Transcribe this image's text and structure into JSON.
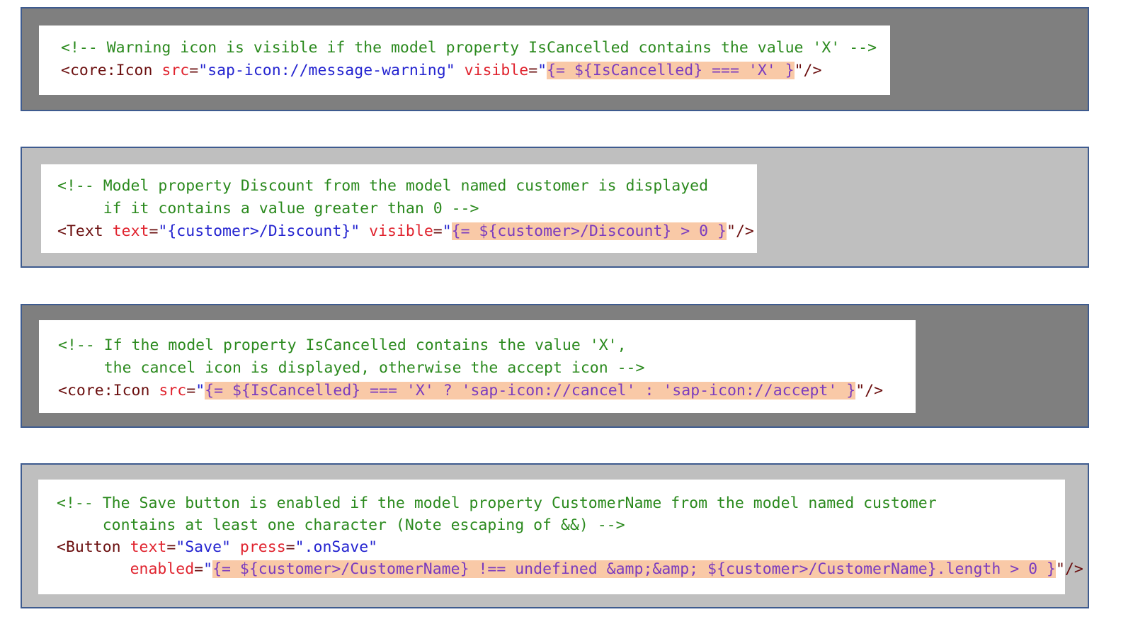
{
  "colors": {
    "panel_border": "#3e5b8f",
    "panel_dark": "#7f7f7f",
    "panel_light": "#bfbfbf",
    "comment": "#2b8a1e",
    "tag": "#6b0f0f",
    "attribute": "#e0232e",
    "string": "#2424d0",
    "highlight_bg": "#f9c9a7",
    "highlight_text": "#7a3bbf"
  },
  "examples": [
    {
      "comment": "<!-- Warning icon is visible if the model property IsCancelled contains the value 'X' -->",
      "tag_open": "<core:Icon",
      "attr1_name": "src",
      "attr1_value": "\"sap-icon://message-warning\"",
      "attr2_name": "visible",
      "expr_open_quote": "\"",
      "expression": "{= ${IsCancelled} === 'X' }",
      "tag_close": "\"/>"
    },
    {
      "comment_line1": "<!-- Model property Discount from the model named customer is displayed",
      "comment_line2": "     if it contains a value greater than 0 -->",
      "tag_open": "<Text",
      "attr1_name": "text",
      "attr1_value": "\"{customer>/Discount}\"",
      "attr2_name": "visible",
      "expr_open_quote": "\"",
      "expression": "{= ${customer>/Discount} > 0 }",
      "tag_close": "\"/>"
    },
    {
      "comment_line1": "<!-- If the model property IsCancelled contains the value 'X',",
      "comment_line2": "     the cancel icon is displayed, otherwise the accept icon -->",
      "tag_open": "<core:Icon",
      "attr1_name": "src",
      "expr_open_quote": "\"",
      "expression": "{= ${IsCancelled} === 'X' ? 'sap-icon://cancel' : 'sap-icon://accept' }",
      "tag_close": "\"/>"
    },
    {
      "comment_line1": "<!-- The Save button is enabled if the model property CustomerName from the model named customer",
      "comment_line2": "     contains at least one character (Note escaping of &&) -->",
      "tag_open": "<Button",
      "attr1_name": "text",
      "attr1_value": "\"Save\"",
      "attr2_name": "press",
      "attr2_value": "\".onSave\"",
      "attr3_name": "enabled",
      "expr_open_quote": "\"",
      "expression": "{= ${customer>/CustomerName} !== undefined &amp;&amp; ${customer>/CustomerName}.length > 0 }",
      "tag_close": "\"/>"
    }
  ]
}
